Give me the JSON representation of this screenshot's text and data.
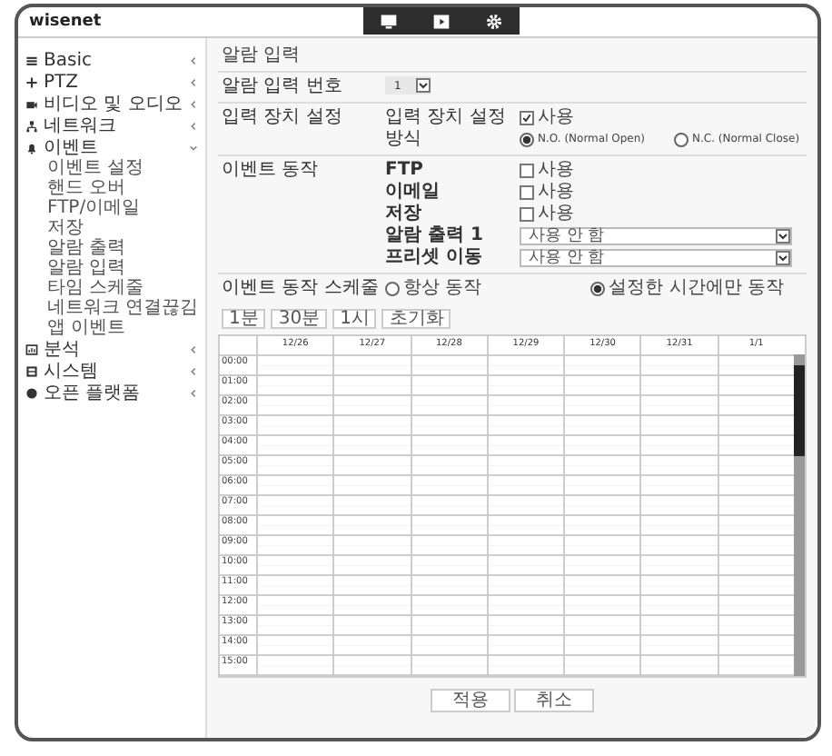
{
  "window": {
    "logo": "wisenet"
  },
  "sidebar": {
    "items": [
      {
        "label": "Basic",
        "expanded": false
      },
      {
        "label": "PTZ",
        "expanded": false
      },
      {
        "label": "비디오 및 오디오",
        "expanded": false
      },
      {
        "label": "네트워크",
        "expanded": false
      },
      {
        "label": "이벤트",
        "expanded": true,
        "children": [
          {
            "label": "이벤트 설정"
          },
          {
            "label": "핸드 오버"
          },
          {
            "label": "FTP/이메일"
          },
          {
            "label": "저장"
          },
          {
            "label": "알람 출력"
          },
          {
            "label": "알람 입력"
          },
          {
            "label": "타임 스케줄"
          },
          {
            "label": "네트워크 연결끊김"
          },
          {
            "label": "앱 이벤트"
          }
        ]
      },
      {
        "label": "분석",
        "expanded": false
      },
      {
        "label": "시스템",
        "expanded": false
      },
      {
        "label": "오픈 플랫폼",
        "expanded": false
      }
    ]
  },
  "page": {
    "title": "알람 입력"
  },
  "alarm_input_number": {
    "label": "알람 입력 번호",
    "value": "1"
  },
  "input_device": {
    "label": "입력 장치 설정",
    "enable": {
      "label": "입력 장치 설정",
      "option": "사용",
      "checked": true
    },
    "mode": {
      "label": "방식",
      "options": [
        {
          "label": "N.O. (Normal Open)",
          "selected": true
        },
        {
          "label": "N.C. (Normal Close)",
          "selected": false
        }
      ]
    }
  },
  "event_action": {
    "label": "이벤트 동작",
    "rows": [
      {
        "kind": "checkbox",
        "label": "FTP",
        "option": "사용",
        "checked": false
      },
      {
        "kind": "checkbox",
        "label": "이메일",
        "option": "사용",
        "checked": false
      },
      {
        "kind": "checkbox",
        "label": "저장",
        "option": "사용",
        "checked": false
      },
      {
        "kind": "select",
        "label": "알람 출력 1",
        "value": "사용 안 함"
      },
      {
        "kind": "select",
        "label": "프리셋 이동",
        "value": "사용 안 함"
      }
    ]
  },
  "schedule": {
    "label": "이벤트 동작 스케줄",
    "options": [
      {
        "label": "항상 동작",
        "selected": false
      },
      {
        "label": "설정한 시간에만 동작",
        "selected": true
      }
    ],
    "buttons": [
      "1분",
      "30분",
      "1시",
      "초기화"
    ],
    "columns": [
      "12/26",
      "12/27",
      "12/28",
      "12/29",
      "12/30",
      "12/31",
      "1/1"
    ],
    "rows": [
      "00:00",
      "01:00",
      "02:00",
      "03:00",
      "04:00",
      "05:00",
      "06:00",
      "07:00",
      "08:00",
      "09:00",
      "10:00",
      "11:00",
      "12:00",
      "13:00",
      "14:00",
      "15:00"
    ]
  },
  "buttons": [
    "적용",
    "취소"
  ]
}
